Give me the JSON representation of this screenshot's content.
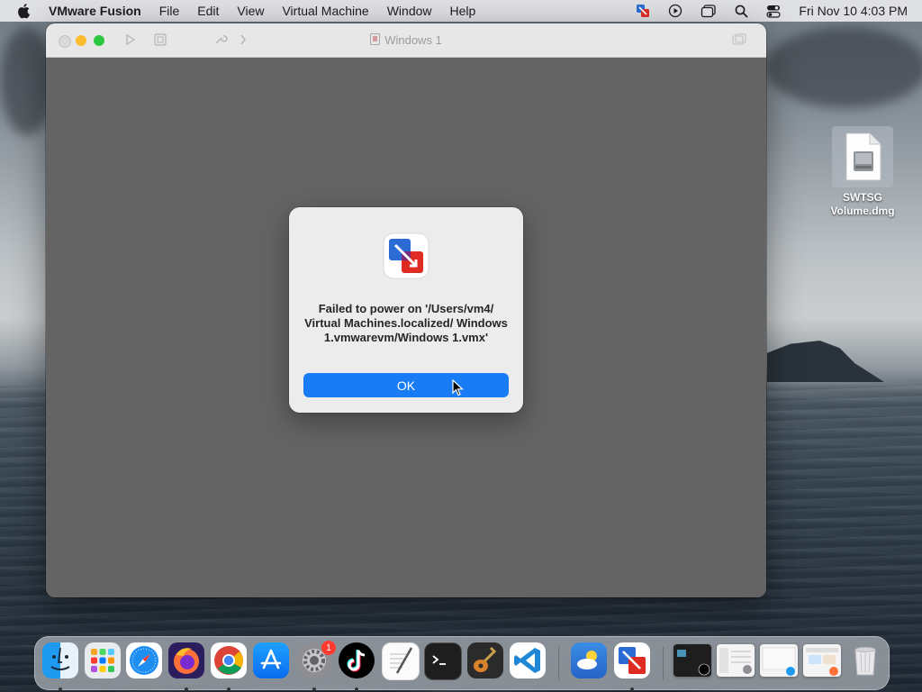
{
  "menubar": {
    "app_name": "VMware Fusion",
    "items": [
      "File",
      "Edit",
      "View",
      "Virtual Machine",
      "Window",
      "Help"
    ],
    "clock": "Fri Nov 10  4:03 PM",
    "status_icons": [
      "vmware-fusion-icon",
      "screen-record-icon",
      "window-icon",
      "spotlight-search-icon",
      "control-center-icon"
    ]
  },
  "window": {
    "title": "Windows 1"
  },
  "dialog": {
    "message": "Failed to power on '/Users/vm4/ Virtual Machines.localized/ Windows 1.vmwarevm/Windows 1.vmx'",
    "ok_label": "OK"
  },
  "desktop": {
    "file_label": "SWTSG Volume.dmg"
  },
  "dock": {
    "apps": [
      "Finder",
      "Launchpad",
      "Safari",
      "Firefox",
      "Chrome",
      "App Store",
      "System Settings",
      "TikTok",
      "TextEdit",
      "Terminal",
      "GarageBand",
      "Visual Studio Code",
      "Weather",
      "VMware Fusion"
    ],
    "system_settings_badge": "1",
    "colors": {
      "accent": "#1a7cf5",
      "badge": "#ff3b30"
    }
  }
}
